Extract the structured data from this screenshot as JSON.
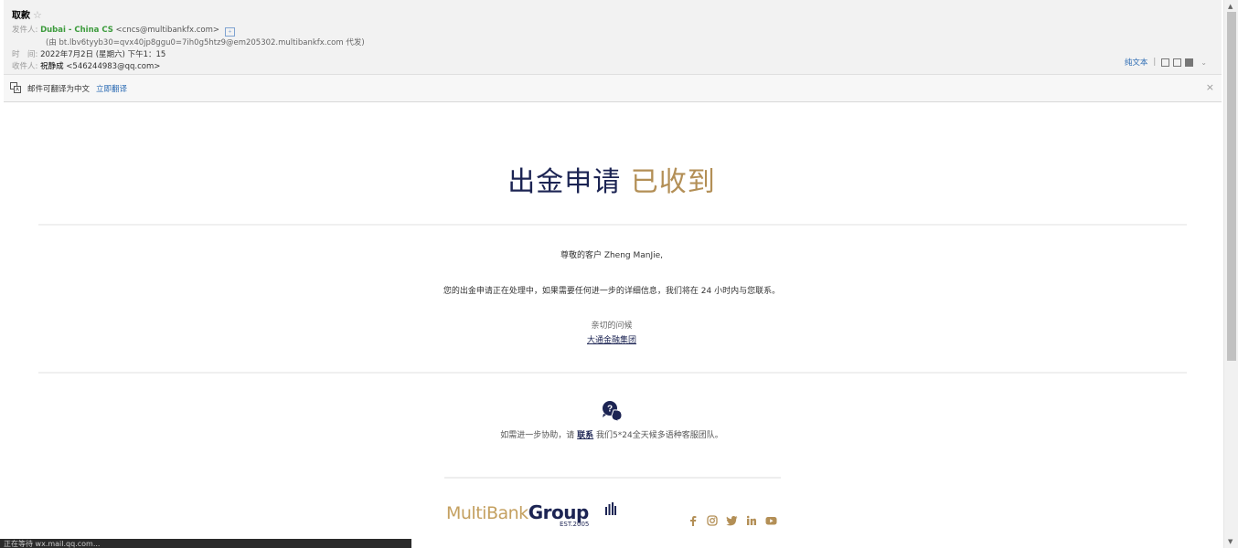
{
  "mail": {
    "subject": "取款",
    "from_label": "发件人:",
    "from_name": "Dubai - China CS",
    "from_email": "<cncs@multibankfx.com>",
    "via": "(由 bt.lbv6tyyb30=qvx40jp8ggu0=7ih0g5htz9@em205302.multibankfx.com 代发)",
    "time_label": "时　间:",
    "time_value": "2022年7月2日 (星期六) 下午1：15",
    "to_label": "收件人:",
    "to_name": "祝静成",
    "to_email": "<546244983@qq.com>",
    "plain_text_link": "纯文本"
  },
  "translate": {
    "message": "邮件可翻译为中文",
    "action": "立即翻译"
  },
  "email": {
    "title_part1": "出金申请",
    "title_part2": "已收到",
    "greeting": "尊敬的客户 Zheng ManJie,",
    "message": "您的出金申请正在处理中，如果需要任何进一步的详细信息，我们将在 24 小时内与您联系。",
    "regards": "亲切的问候",
    "company": "大通金融集团",
    "help_prefix": "如需进一步协助，请",
    "help_link": "联系",
    "help_suffix": "我们5*24全天候多语种客服团队。"
  },
  "logo": {
    "part1": "Multi",
    "part2": "Bank",
    "part3": "Group",
    "est": "EST.2005"
  },
  "social_icons": [
    "facebook-icon",
    "instagram-icon",
    "twitter-icon",
    "linkedin-icon",
    "youtube-icon"
  ],
  "status_bar": "正在等待 wx.mail.qq.com...",
  "colors": {
    "navy": "#1c2453",
    "gold": "#b38f56",
    "sender_green": "#3c9b3c",
    "link_blue": "#2a6ab3"
  }
}
